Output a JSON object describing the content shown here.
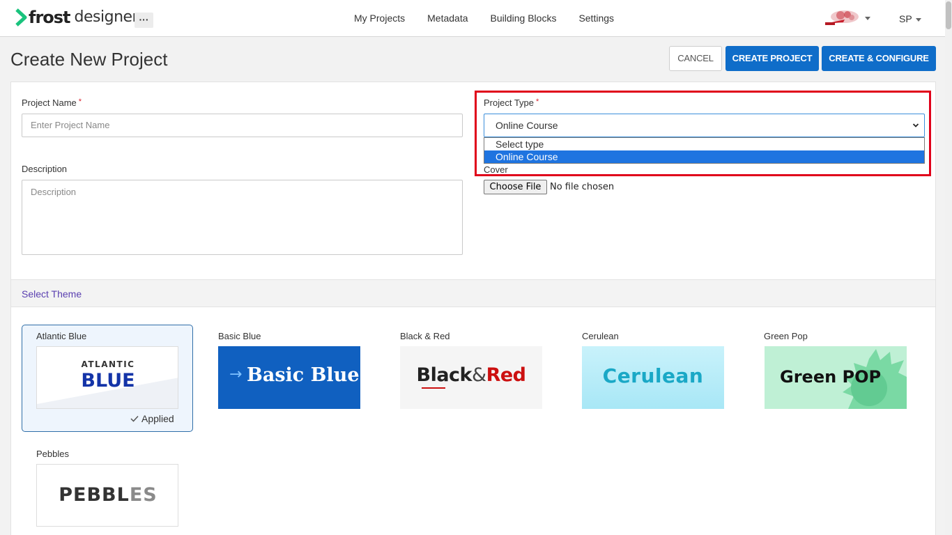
{
  "brand": {
    "name_bold": "frost",
    "name_light": "designer",
    "more_label": "···"
  },
  "nav": {
    "links": [
      "My Projects",
      "Metadata",
      "Building Blocks",
      "Settings"
    ],
    "user_initials": "SP"
  },
  "page": {
    "title": "Create New Project",
    "cancel_label": "CANCEL",
    "create_label": "CREATE PROJECT",
    "configure_label": "CREATE & CONFIGURE"
  },
  "form": {
    "project_name": {
      "label": "Project Name",
      "required_mark": "*",
      "placeholder": "Enter Project Name",
      "value": ""
    },
    "description": {
      "label": "Description",
      "placeholder": "Description",
      "value": ""
    },
    "project_type": {
      "label": "Project Type",
      "required_mark": "*",
      "selected": "Online Course",
      "options": [
        "Select type",
        "Online Course"
      ],
      "highlighted_option": "Online Course"
    },
    "cover": {
      "label": "Cover",
      "button_label": "Choose File",
      "status": "No file chosen"
    }
  },
  "themes": {
    "section_title": "Select Theme",
    "applied_label": "Applied",
    "items": [
      {
        "name": "Atlantic Blue",
        "thumb_line1": "ATLANTIC",
        "thumb_line2": "BLUE",
        "applied": true
      },
      {
        "name": "Basic Blue",
        "thumb_text": "Basic Blue",
        "applied": false
      },
      {
        "name": "Black & Red",
        "thumb_part1": "Black",
        "thumb_amp": "&",
        "thumb_part2": "Red",
        "applied": false
      },
      {
        "name": "Cerulean",
        "thumb_text": "Cerulean",
        "applied": false
      },
      {
        "name": "Green Pop",
        "thumb_text": "Green POP",
        "applied": false
      },
      {
        "name": "Pebbles",
        "thumb_part1": "PEBBL",
        "thumb_part2": "ES",
        "applied": false
      }
    ]
  },
  "colors": {
    "primary": "#0f6dc9",
    "highlight": "#e0001a",
    "theme_title": "#5a3fb0",
    "logo_green": "#19c37d"
  }
}
